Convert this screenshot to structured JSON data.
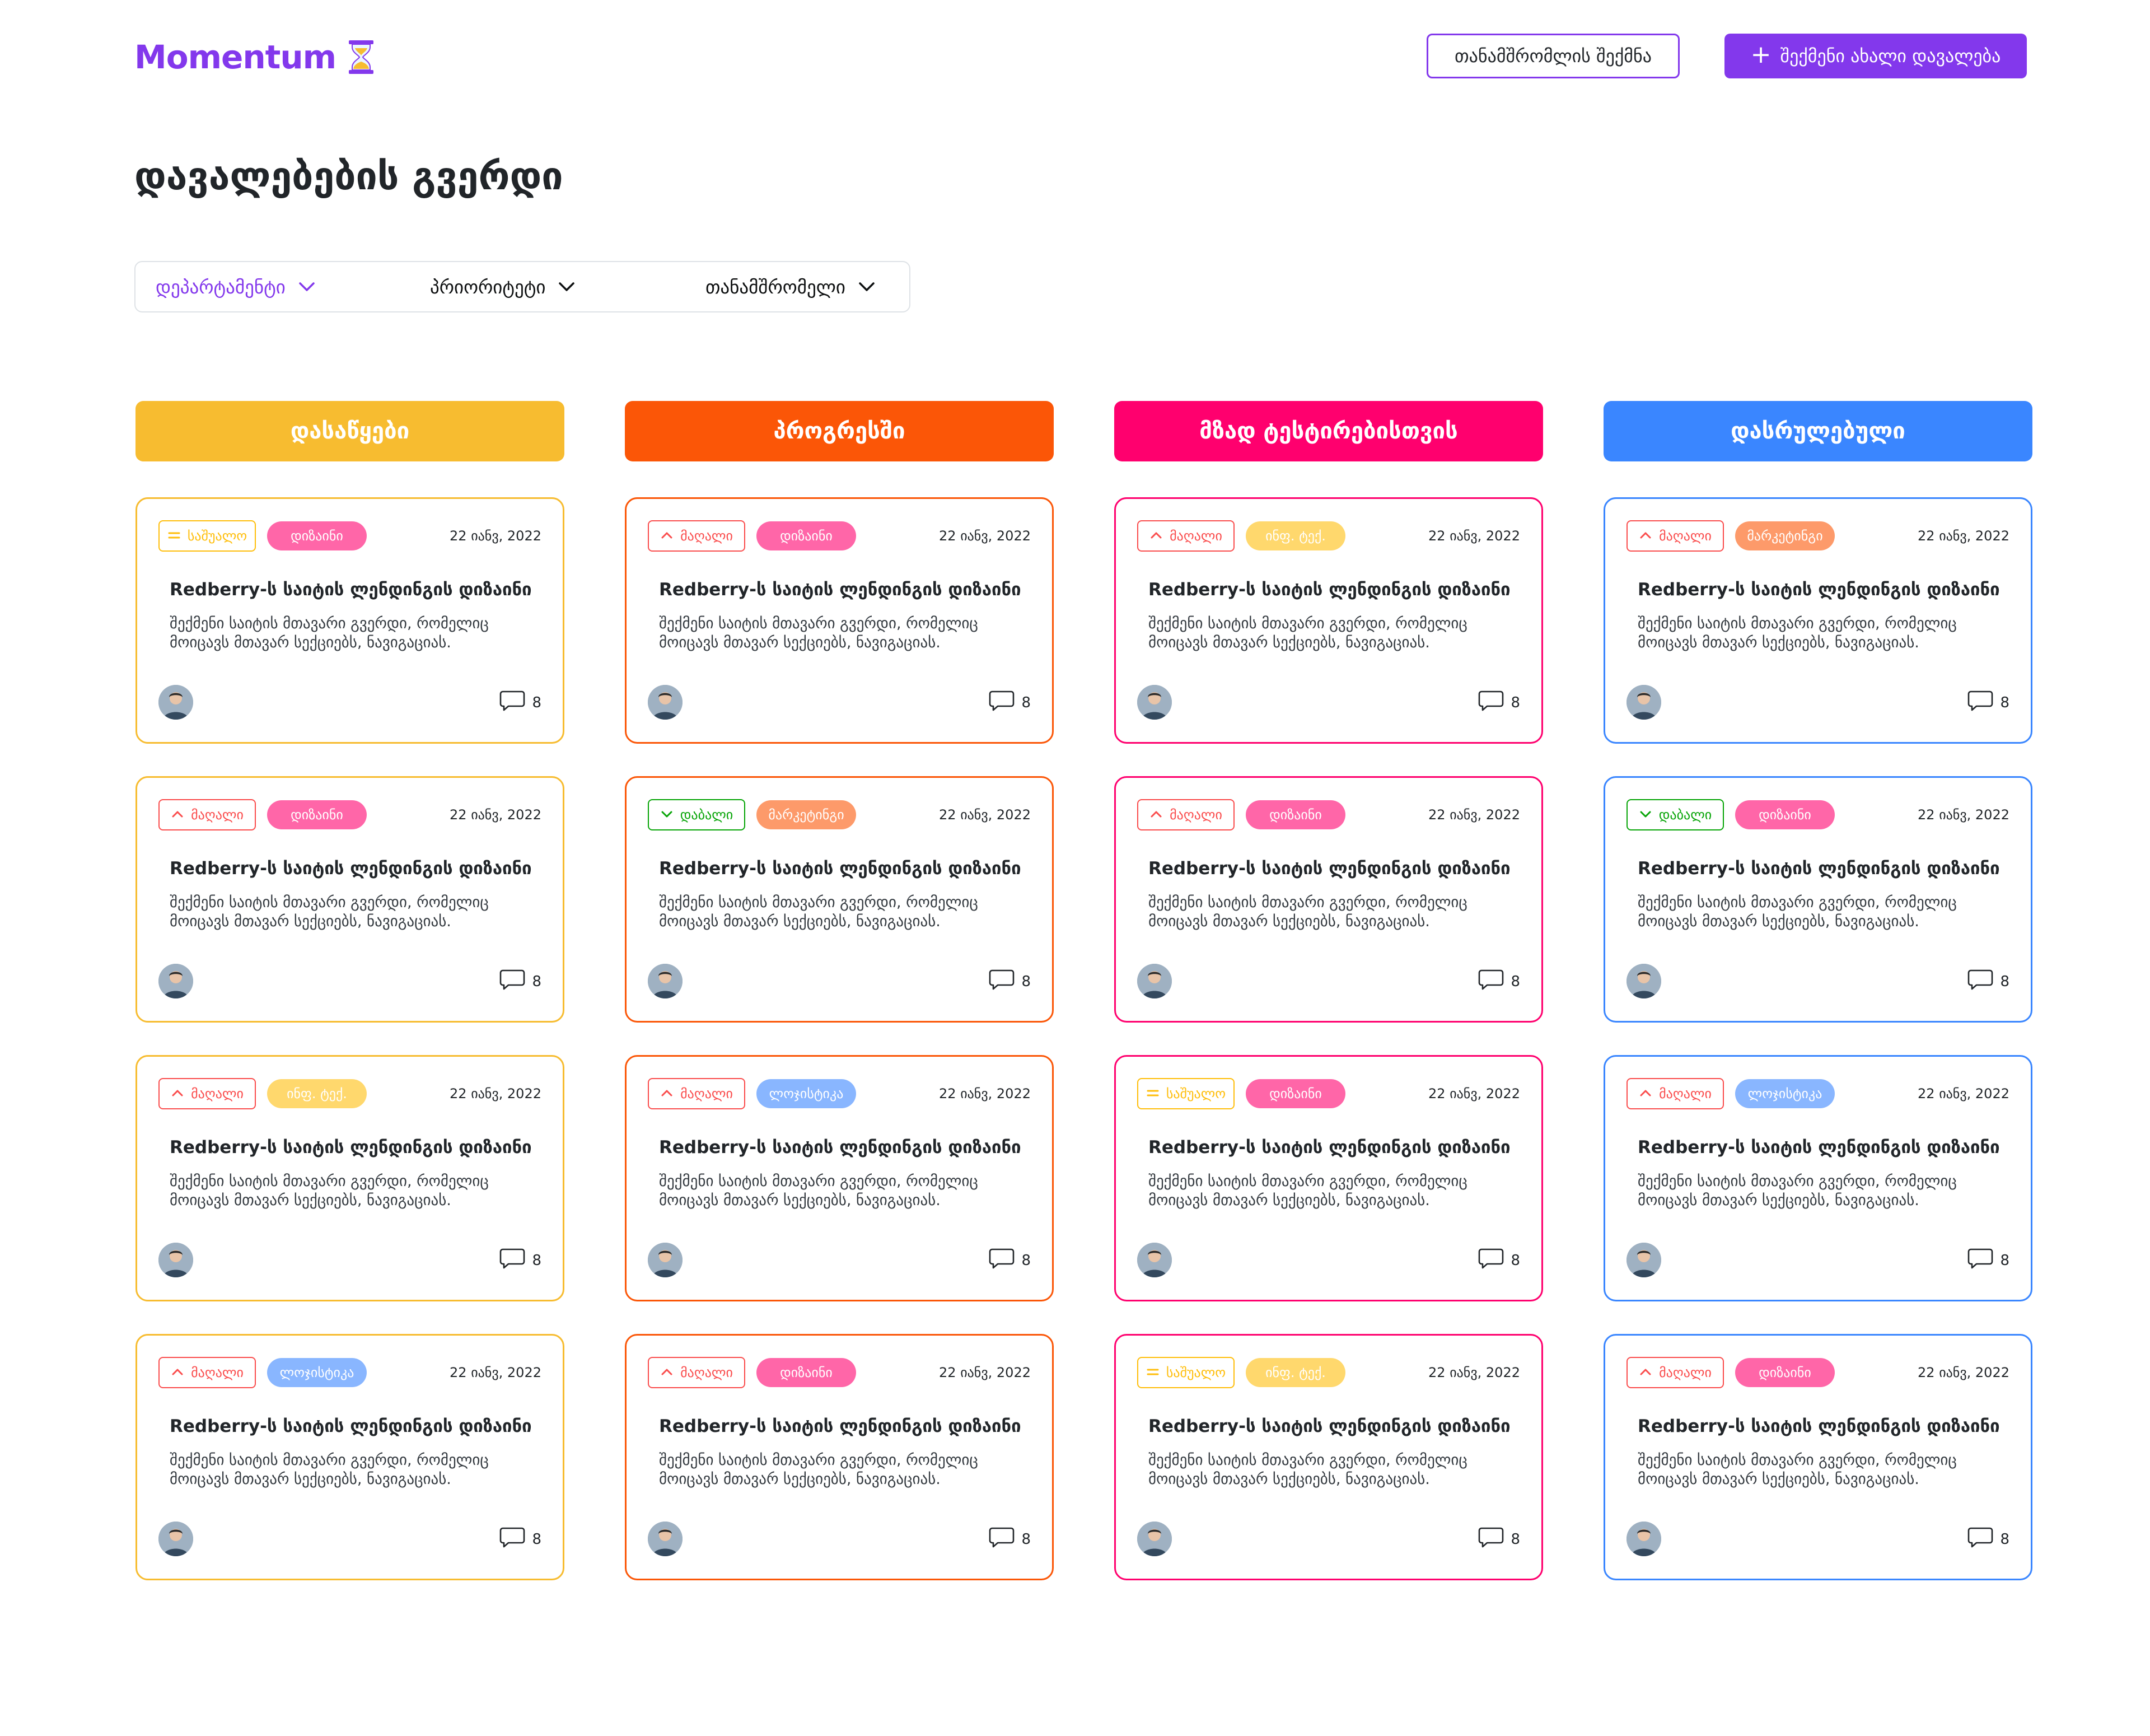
{
  "app": {
    "logo_text": "Momentum",
    "logo_icon": "hourglass-icon",
    "brand_color": "#8338EC"
  },
  "header": {
    "create_employee_label": "თანამშრომლის შექმნა",
    "create_task_label": "შექმენი ახალი დავალება",
    "create_task_icon": "plus-icon"
  },
  "page": {
    "title": "დავალებების გვერდი"
  },
  "filters": [
    {
      "label": "დეპარტამენტი",
      "active": true
    },
    {
      "label": "პრიორიტეტი",
      "active": false
    },
    {
      "label": "თანამშრომელი",
      "active": false
    }
  ],
  "priorities": {
    "medium": {
      "label": "საშუალო",
      "color": "#FFBE0B",
      "icon": "equals-icon"
    },
    "high": {
      "label": "მაღალი",
      "color": "#FA4D4D",
      "icon": "chevron-up-icon"
    },
    "low": {
      "label": "დაბალი",
      "color": "#08A508",
      "icon": "chevron-down-icon"
    }
  },
  "departments": {
    "design": {
      "label": "დიზაინი",
      "color": "#FF66A8"
    },
    "marketing": {
      "label": "მარკეტინგი",
      "color": "#FD9A6A"
    },
    "it": {
      "label": "ინფ. ტექ.",
      "color": "#FFD86D"
    },
    "logistics": {
      "label": "ლოჯისტიკა",
      "color": "#89B6FF"
    }
  },
  "columns": [
    {
      "title": "დასაწყები",
      "color": "#F7BC30",
      "cards": [
        {
          "priority": "medium",
          "department": "design",
          "date": "22 იანვ, 2022",
          "title": "Redberry-ს საიტის ლენდინგის დიზაინი",
          "description": "შექმენი საიტის მთავარი გვერდი, რომელიც მოიცავს მთავარ სექციებს, ნავიგაციას.",
          "comments": "8"
        },
        {
          "priority": "high",
          "department": "design",
          "date": "22 იანვ, 2022",
          "title": "Redberry-ს საიტის ლენდინგის დიზაინი",
          "description": "შექმენი საიტის მთავარი გვერდი, რომელიც მოიცავს მთავარ სექციებს, ნავიგაციას.",
          "comments": "8"
        },
        {
          "priority": "high",
          "department": "it",
          "date": "22 იანვ, 2022",
          "title": "Redberry-ს საიტის ლენდინგის დიზაინი",
          "description": "შექმენი საიტის მთავარი გვერდი, რომელიც მოიცავს მთავარ სექციებს, ნავიგაციას.",
          "comments": "8"
        },
        {
          "priority": "high",
          "department": "logistics",
          "date": "22 იანვ, 2022",
          "title": "Redberry-ს საიტის ლენდინგის დიზაინი",
          "description": "შექმენი საიტის მთავარი გვერდი, რომელიც მოიცავს მთავარ სექციებს, ნავიგაციას.",
          "comments": "8"
        }
      ]
    },
    {
      "title": "პროგრესში",
      "color": "#FB5607",
      "cards": [
        {
          "priority": "high",
          "department": "design",
          "date": "22 იანვ, 2022",
          "title": "Redberry-ს საიტის ლენდინგის დიზაინი",
          "description": "შექმენი საიტის მთავარი გვერდი, რომელიც მოიცავს მთავარ სექციებს, ნავიგაციას.",
          "comments": "8"
        },
        {
          "priority": "low",
          "department": "marketing",
          "date": "22 იანვ, 2022",
          "title": "Redberry-ს საიტის ლენდინგის დიზაინი",
          "description": "შექმენი საიტის მთავარი გვერდი, რომელიც მოიცავს მთავარ სექციებს, ნავიგაციას.",
          "comments": "8"
        },
        {
          "priority": "high",
          "department": "logistics",
          "date": "22 იანვ, 2022",
          "title": "Redberry-ს საიტის ლენდინგის დიზაინი",
          "description": "შექმენი საიტის მთავარი გვერდი, რომელიც მოიცავს მთავარ სექციებს, ნავიგაციას.",
          "comments": "8"
        },
        {
          "priority": "high",
          "department": "design",
          "date": "22 იანვ, 2022",
          "title": "Redberry-ს საიტის ლენდინგის დიზაინი",
          "description": "შექმენი საიტის მთავარი გვერდი, რომელიც მოიცავს მთავარ სექციებს, ნავიგაციას.",
          "comments": "8"
        }
      ]
    },
    {
      "title": "მზად ტესტირებისთვის",
      "color": "#FF006E",
      "cards": [
        {
          "priority": "high",
          "department": "it",
          "date": "22 იანვ, 2022",
          "title": "Redberry-ს საიტის ლენდინგის დიზაინი",
          "description": "შექმენი საიტის მთავარი გვერდი, რომელიც მოიცავს მთავარ სექციებს, ნავიგაციას.",
          "comments": "8"
        },
        {
          "priority": "high",
          "department": "design",
          "date": "22 იანვ, 2022",
          "title": "Redberry-ს საიტის ლენდინგის დიზაინი",
          "description": "შექმენი საიტის მთავარი გვერდი, რომელიც მოიცავს მთავარ სექციებს, ნავიგაციას.",
          "comments": "8"
        },
        {
          "priority": "medium",
          "department": "design",
          "date": "22 იანვ, 2022",
          "title": "Redberry-ს საიტის ლენდინგის დიზაინი",
          "description": "შექმენი საიტის მთავარი გვერდი, რომელიც მოიცავს მთავარ სექციებს, ნავიგაციას.",
          "comments": "8"
        },
        {
          "priority": "medium",
          "department": "it",
          "date": "22 იანვ, 2022",
          "title": "Redberry-ს საიტის ლენდინგის დიზაინი",
          "description": "შექმენი საიტის მთავარი გვერდი, რომელიც მოიცავს მთავარ სექციებს, ნავიგაციას.",
          "comments": "8"
        }
      ]
    },
    {
      "title": "დასრულებული",
      "color": "#3A86FF",
      "cards": [
        {
          "priority": "high",
          "department": "marketing",
          "date": "22 იანვ, 2022",
          "title": "Redberry-ს საიტის ლენდინგის დიზაინი",
          "description": "შექმენი საიტის მთავარი გვერდი, რომელიც მოიცავს მთავარ სექციებს, ნავიგაციას.",
          "comments": "8"
        },
        {
          "priority": "low",
          "department": "design",
          "date": "22 იანვ, 2022",
          "title": "Redberry-ს საიტის ლენდინგის დიზაინი",
          "description": "შექმენი საიტის მთავარი გვერდი, რომელიც მოიცავს მთავარ სექციებს, ნავიგაციას.",
          "comments": "8"
        },
        {
          "priority": "high",
          "department": "logistics",
          "date": "22 იანვ, 2022",
          "title": "Redberry-ს საიტის ლენდინგის დიზაინი",
          "description": "შექმენი საიტის მთავარი გვერდი, რომელიც მოიცავს მთავარ სექციებს, ნავიგაციას.",
          "comments": "8"
        },
        {
          "priority": "high",
          "department": "design",
          "date": "22 იანვ, 2022",
          "title": "Redberry-ს საიტის ლენდინგის დიზაინი",
          "description": "შექმენი საიტის მთავარი გვერდი, რომელიც მოიცავს მთავარ სექციებს, ნავიგაციას.",
          "comments": "8"
        }
      ]
    }
  ]
}
